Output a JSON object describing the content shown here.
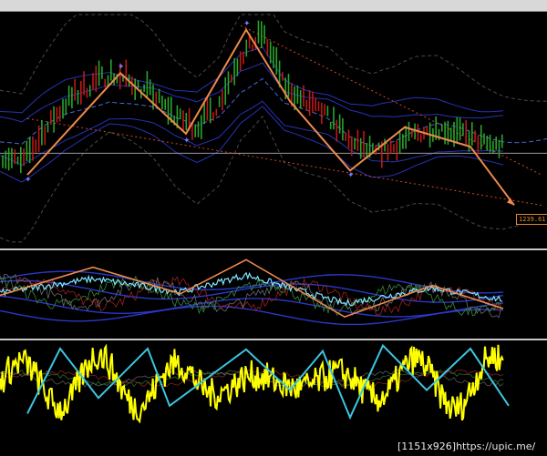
{
  "price_tag": "1239.61",
  "watermark": "[1151x926]https://upic.me/",
  "colors": {
    "background": "#000000",
    "candle_up": "#2aa52a",
    "candle_down": "#c01818",
    "zigzag_main": "#f08a4b",
    "zigzag_cyan": "#3cc6e0",
    "oscillator_yellow": "#ffff00",
    "band_blue": "#2a38c8",
    "band_dashed": "#3b3b3b",
    "trend_dotted": "#d04a20",
    "separator": "#c8c8c8"
  },
  "chart_data": [
    {
      "type": "line",
      "panel": "price",
      "xlim": [
        0,
        100
      ],
      "ylim": [
        0,
        100
      ],
      "zigzag": {
        "x": [
          5,
          22,
          34,
          45,
          53,
          64,
          74,
          86,
          94
        ],
        "y": [
          26,
          73,
          45,
          93,
          60,
          28,
          48,
          39,
          12
        ]
      },
      "price_series_up": {
        "x": [
          0,
          4,
          8,
          12,
          16,
          20,
          24,
          28,
          32,
          36,
          40,
          44,
          48,
          52,
          56,
          60,
          64,
          68,
          72,
          76,
          80,
          84,
          88,
          92
        ],
        "y": [
          35,
          30,
          45,
          58,
          66,
          72,
          68,
          62,
          52,
          47,
          58,
          80,
          90,
          66,
          58,
          52,
          40,
          35,
          38,
          44,
          47,
          44,
          40,
          38
        ]
      },
      "trendlines": [
        {
          "x": [
            44,
            99
          ],
          "y": [
            95,
            26
          ]
        },
        {
          "x": [
            5,
            99
          ],
          "y": [
            52,
            12
          ]
        }
      ],
      "markers": {
        "x": [
          5,
          22,
          34,
          45,
          64
        ],
        "y": [
          24,
          76,
          42,
          96,
          26
        ]
      }
    },
    {
      "type": "line",
      "panel": "oscillator",
      "xlim": [
        0,
        100
      ],
      "ylim": [
        0,
        100
      ],
      "zigzag": {
        "x": [
          0,
          17,
          33,
          45,
          63,
          79,
          92
        ],
        "y": [
          50,
          84,
          52,
          93,
          24,
          62,
          34
        ]
      }
    },
    {
      "type": "line",
      "panel": "momentum",
      "xlim": [
        0,
        100
      ],
      "ylim": [
        0,
        100
      ],
      "zigzag": {
        "x": [
          5,
          11,
          18,
          27,
          31,
          45,
          53,
          59,
          64,
          70,
          78,
          86,
          93
        ],
        "y": [
          10,
          93,
          30,
          93,
          20,
          92,
          40,
          90,
          5,
          97,
          40,
          93,
          20
        ]
      }
    }
  ]
}
